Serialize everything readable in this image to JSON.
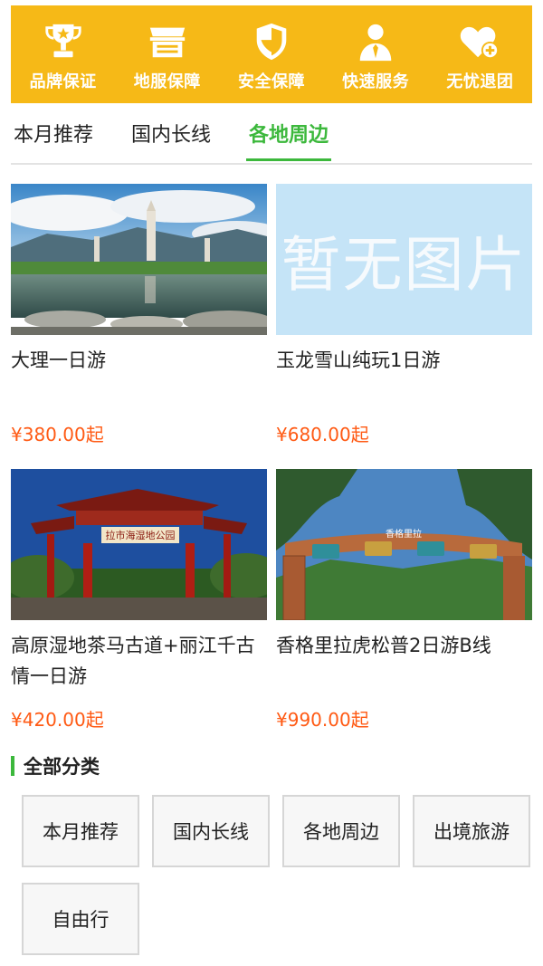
{
  "guarantees": [
    {
      "label": "品牌保证",
      "icon": "trophy-icon"
    },
    {
      "label": "地服保障",
      "icon": "storefront-icon"
    },
    {
      "label": "安全保障",
      "icon": "shield-icon"
    },
    {
      "label": "快速服务",
      "icon": "service-agent-icon"
    },
    {
      "label": "无忧退团",
      "icon": "heart-plus-icon"
    }
  ],
  "tabs": [
    {
      "label": "本月推荐",
      "active": false
    },
    {
      "label": "国内长线",
      "active": false
    },
    {
      "label": "各地周边",
      "active": true
    }
  ],
  "products": [
    {
      "title": "大理一日游",
      "price": "¥380.00起",
      "image": "dali-pagodas-lake"
    },
    {
      "title": "玉龙雪山纯玩1日游",
      "price": "¥680.00起",
      "image": "placeholder",
      "placeholder_text": "暂无图片"
    },
    {
      "title": "高原湿地茶马古道+丽江千古情一日游",
      "price": "¥420.00起",
      "image": "wetland-park-gate",
      "gate_sign": "拉市海湿地公园"
    },
    {
      "title": "香格里拉虎松普2日游B线",
      "price": "¥990.00起",
      "image": "shangri-la-gate",
      "gate_sign": "香格里拉"
    }
  ],
  "categories": {
    "title": "全部分类",
    "items": [
      "本月推荐",
      "国内长线",
      "各地周边",
      "出境旅游",
      "自由行"
    ]
  },
  "colors": {
    "banner": "#f6b917",
    "accent_green": "#3cb83c",
    "price_orange": "#ff5a14",
    "placeholder_blue": "#c5e4f7"
  }
}
